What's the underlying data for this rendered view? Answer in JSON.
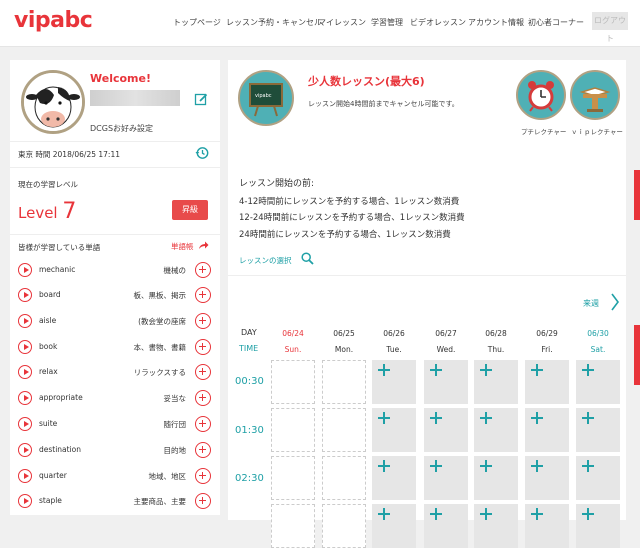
{
  "header": {
    "logo": "vipabc",
    "nav": [
      "トップページ",
      "レッスン予約・キャンセル",
      "マイレッスン",
      "学習管理",
      "ビデオレッスン",
      "アカウント情報",
      "初心者コーナー"
    ],
    "logout": "ログアウト"
  },
  "profile": {
    "welcome": "Welcome!",
    "subtitle": "DCGSお好み設定",
    "datetime": "東京 時間  2018/06/25 17:11",
    "level_label": "現在の学習レベル",
    "level_word": "Level",
    "level_number": "7",
    "upgrade_label": "昇級",
    "words_label": "皆様が学習している単語",
    "vocab_link": "単語帳",
    "words": [
      {
        "en": "mechanic",
        "jp": "機械の"
      },
      {
        "en": "board",
        "jp": "板、黒板、掲示"
      },
      {
        "en": "aisle",
        "jp": "(教会堂の座席"
      },
      {
        "en": "book",
        "jp": "本、書物、書籍"
      },
      {
        "en": "relax",
        "jp": "リラックスする"
      },
      {
        "en": "appropriate",
        "jp": "妥当な"
      },
      {
        "en": "suite",
        "jp": "随行団"
      },
      {
        "en": "destination",
        "jp": "目的地"
      },
      {
        "en": "quarter",
        "jp": "地域、地区"
      },
      {
        "en": "staple",
        "jp": "主要商品、主要"
      }
    ]
  },
  "lesson": {
    "title": "少人数レッスン(最大6)",
    "description": "レッスン開始4時間前までキャンセル可能です。",
    "icons": [
      {
        "label": "プチレクチャー",
        "icon": "alarm-clock-icon"
      },
      {
        "label": "ｖｉｐレクチャー",
        "icon": "lectern-book-icon"
      }
    ],
    "rules_heading": "レッスン開始の前:",
    "rules": [
      "4-12時間前にレッスンを予約する場合、1レッスン数消費",
      "12-24時間前にレッスンを予約する場合、1レッスン数消費",
      "24時間前にレッスンを予約する場合、1レッスン数消費"
    ],
    "select_link": "レッスンの選択",
    "next_week": "来週"
  },
  "schedule": {
    "day_label": "DAY",
    "time_label": "TIME",
    "days": [
      {
        "date": "06/24",
        "dow": "Sun."
      },
      {
        "date": "06/25",
        "dow": "Mon."
      },
      {
        "date": "06/26",
        "dow": "Tue."
      },
      {
        "date": "06/27",
        "dow": "Wed."
      },
      {
        "date": "06/28",
        "dow": "Thu."
      },
      {
        "date": "06/29",
        "dow": "Fri."
      },
      {
        "date": "06/30",
        "dow": "Sat."
      }
    ],
    "times": [
      "00:30",
      "01:30",
      "02:30"
    ],
    "open_days": [
      2,
      3,
      4,
      5,
      6
    ]
  },
  "colors": {
    "accent": "#e8343a",
    "teal": "#1fa0a6",
    "icon_bg": "#4fb0b5"
  }
}
